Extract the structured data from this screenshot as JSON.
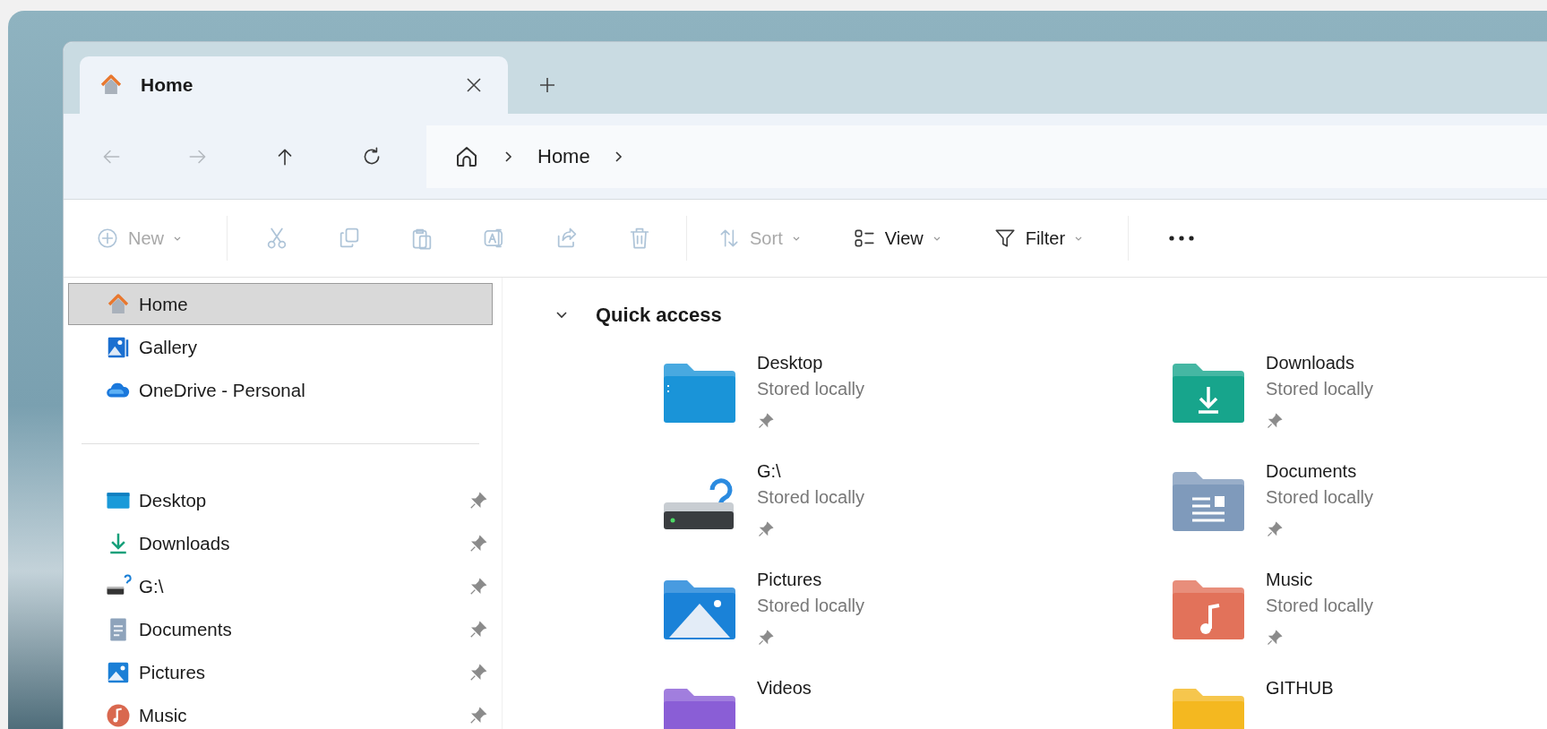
{
  "tabs": [
    {
      "label": "Home",
      "kind": "home",
      "selected": true
    }
  ],
  "nav": [
    {
      "kind": "back",
      "disabled": true
    },
    {
      "kind": "forward",
      "disabled": true
    },
    {
      "kind": "up",
      "disabled": false
    },
    {
      "kind": "refresh",
      "disabled": false
    }
  ],
  "address": {
    "kind": "home",
    "crumbs": [
      "Home"
    ]
  },
  "toolbar": [
    {
      "kind": "new",
      "label": "New",
      "disabled": true
    },
    {
      "kind": "separator"
    },
    {
      "kind": "cut",
      "disabled": true
    },
    {
      "kind": "copy",
      "disabled": true
    },
    {
      "kind": "paste",
      "disabled": true
    },
    {
      "kind": "rename",
      "disabled": true
    },
    {
      "kind": "share",
      "disabled": true
    },
    {
      "kind": "delete",
      "disabled": true
    },
    {
      "kind": "separator"
    },
    {
      "kind": "sort",
      "label": "Sort",
      "disabled": true
    },
    {
      "kind": "view",
      "label": "View",
      "disabled": false
    },
    {
      "kind": "filter",
      "label": "Filter",
      "disabled": false
    },
    {
      "kind": "separator"
    },
    {
      "kind": "more",
      "disabled": false
    }
  ],
  "sidebar": {
    "top": [
      {
        "label": "Home",
        "kind": "home",
        "selected": true,
        "pinned": false
      },
      {
        "label": "Gallery",
        "kind": "gallery",
        "selected": false,
        "pinned": false
      },
      {
        "label": "OneDrive - Personal",
        "kind": "cloud",
        "selected": false,
        "pinned": false
      }
    ],
    "pinned": [
      {
        "label": "Desktop",
        "kind": "desktop",
        "selected": false,
        "pinned": true
      },
      {
        "label": "Downloads",
        "kind": "downloads",
        "selected": false,
        "pinned": true
      },
      {
        "label": "G:\\",
        "kind": "drive",
        "selected": false,
        "pinned": true
      },
      {
        "label": "Documents",
        "kind": "documents",
        "selected": false,
        "pinned": true
      },
      {
        "label": "Pictures",
        "kind": "pictures",
        "selected": false,
        "pinned": true
      },
      {
        "label": "Music",
        "kind": "music",
        "selected": false,
        "pinned": true
      }
    ]
  },
  "quick_access": {
    "title": "Quick access",
    "expanded": true,
    "items": [
      {
        "name": "Desktop",
        "kind": "desktop",
        "status": "Stored locally",
        "pinned": true
      },
      {
        "name": "Downloads",
        "kind": "downloads",
        "status": "Stored locally",
        "pinned": true
      },
      {
        "name": "G:\\",
        "kind": "drive",
        "status": "Stored locally",
        "pinned": true
      },
      {
        "name": "Documents",
        "kind": "documents",
        "status": "Stored locally",
        "pinned": true
      },
      {
        "name": "Pictures",
        "kind": "pictures",
        "status": "Stored locally",
        "pinned": true
      },
      {
        "name": "Music",
        "kind": "music",
        "status": "Stored locally",
        "pinned": true
      },
      {
        "name": "Videos",
        "kind": "videos"
      },
      {
        "name": "GITHUB",
        "kind": "folder"
      }
    ]
  }
}
